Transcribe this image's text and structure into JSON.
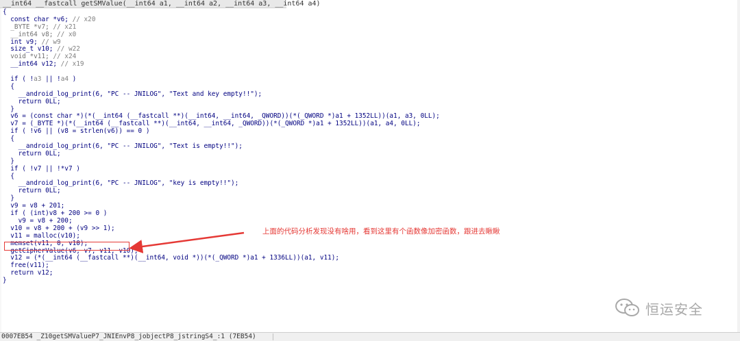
{
  "header": {
    "signature": "__int64 __fastcall getSMValue(__int64 a1, __int64 a2, __int64 a3, __int64 a4)"
  },
  "code_lines": [
    [
      {
        "t": "{",
        "c": "normal"
      }
    ],
    [
      {
        "t": "  const char *v6; ",
        "c": "normal"
      },
      {
        "t": "// x20",
        "c": "comment"
      }
    ],
    [
      {
        "t": "  _BYTE *v7; ",
        "c": "gray"
      },
      {
        "t": "// x21",
        "c": "comment"
      }
    ],
    [
      {
        "t": "  __int64 v8; ",
        "c": "gray"
      },
      {
        "t": "// x0",
        "c": "comment"
      }
    ],
    [
      {
        "t": "  int v9; ",
        "c": "normal"
      },
      {
        "t": "// w9",
        "c": "comment"
      }
    ],
    [
      {
        "t": "  size_t v10; ",
        "c": "normal"
      },
      {
        "t": "// w22",
        "c": "comment"
      }
    ],
    [
      {
        "t": "  void *v11; ",
        "c": "gray"
      },
      {
        "t": "// x24",
        "c": "comment"
      }
    ],
    [
      {
        "t": "  __int64 v12; ",
        "c": "normal"
      },
      {
        "t": "// x19",
        "c": "comment"
      }
    ],
    [
      {
        "t": "",
        "c": "normal"
      }
    ],
    [
      {
        "t": "  if ( !",
        "c": "normal"
      },
      {
        "t": "a3",
        "c": "var"
      },
      {
        "t": " || !",
        "c": "normal"
      },
      {
        "t": "a4",
        "c": "var"
      },
      {
        "t": " )",
        "c": "normal"
      }
    ],
    [
      {
        "t": "  {",
        "c": "normal"
      }
    ],
    [
      {
        "t": "    __android_log_print(6, \"PC -- JNILOG\", \"Text and key empty!!\");",
        "c": "normal"
      }
    ],
    [
      {
        "t": "    return 0LL;",
        "c": "normal"
      }
    ],
    [
      {
        "t": "  }",
        "c": "normal"
      }
    ],
    [
      {
        "t": "  v6 = (const char *)(*(__int64 (__fastcall **)(__int64, __int64, _QWORD))(*(_QWORD *)a1 + 1352LL))(a1, a3, 0LL);",
        "c": "normal"
      }
    ],
    [
      {
        "t": "  v7 = (_BYTE *)(*(__int64 (__fastcall **)(__int64, __int64, _QWORD))(*(_QWORD *)a1 + 1352LL))(a1, a4, 0LL);",
        "c": "normal"
      }
    ],
    [
      {
        "t": "  if ( !v6 || (v8 = strlen(v6)) == 0 )",
        "c": "normal"
      }
    ],
    [
      {
        "t": "  {",
        "c": "normal"
      }
    ],
    [
      {
        "t": "    __android_log_print(6, \"PC -- JNILOG\", \"Text is empty!!\");",
        "c": "normal"
      }
    ],
    [
      {
        "t": "    return 0LL;",
        "c": "normal"
      }
    ],
    [
      {
        "t": "  }",
        "c": "normal"
      }
    ],
    [
      {
        "t": "  if ( !v7 || !*v7 )",
        "c": "normal"
      }
    ],
    [
      {
        "t": "  {",
        "c": "normal"
      }
    ],
    [
      {
        "t": "    __android_log_print(6, \"PC -- JNILOG\", \"key is empty!!\");",
        "c": "normal"
      }
    ],
    [
      {
        "t": "    return 0LL;",
        "c": "normal"
      }
    ],
    [
      {
        "t": "  }",
        "c": "normal"
      }
    ],
    [
      {
        "t": "  v9 = v8 + 201;",
        "c": "normal"
      }
    ],
    [
      {
        "t": "  if ( (int)v8 + 200 >= 0 )",
        "c": "normal"
      }
    ],
    [
      {
        "t": "    v9 = v8 + 200;",
        "c": "normal"
      }
    ],
    [
      {
        "t": "  v10 = v8 + 200 + (v9 >> 1);",
        "c": "normal"
      }
    ],
    [
      {
        "t": "  v11 = malloc(v10);",
        "c": "normal"
      }
    ],
    [
      {
        "t": "  memset(v11, 0, v10);",
        "c": "normal"
      }
    ],
    [
      {
        "t": "  getCipherValue(v6, v7, v11, v10);",
        "c": "normal"
      }
    ],
    [
      {
        "t": "  v12 = (*(__int64 (__fastcall **)(__int64, void *))(*(_QWORD *)a1 + 1336LL))(a1, v11);",
        "c": "normal"
      }
    ],
    [
      {
        "t": "  free(v11);",
        "c": "normal"
      }
    ],
    [
      {
        "t": "  return v12;",
        "c": "normal"
      }
    ],
    [
      {
        "t": "}",
        "c": "normal"
      }
    ]
  ],
  "annotation": {
    "text": "上面的代码分析发现没有啥用，看到这里有个函数像加密函数，跟进去瞅瞅",
    "color": "#e53935"
  },
  "status": {
    "text": "0007EB54 _Z10getSMValueP7_JNIEnvP8_jobjectP8_jstringS4_:1 (7EB54)"
  },
  "watermark": {
    "text": "恒运安全",
    "icon": "wechat-icon"
  },
  "colors": {
    "code": "#000080",
    "comment": "#808080",
    "highlight": "#e53935"
  }
}
